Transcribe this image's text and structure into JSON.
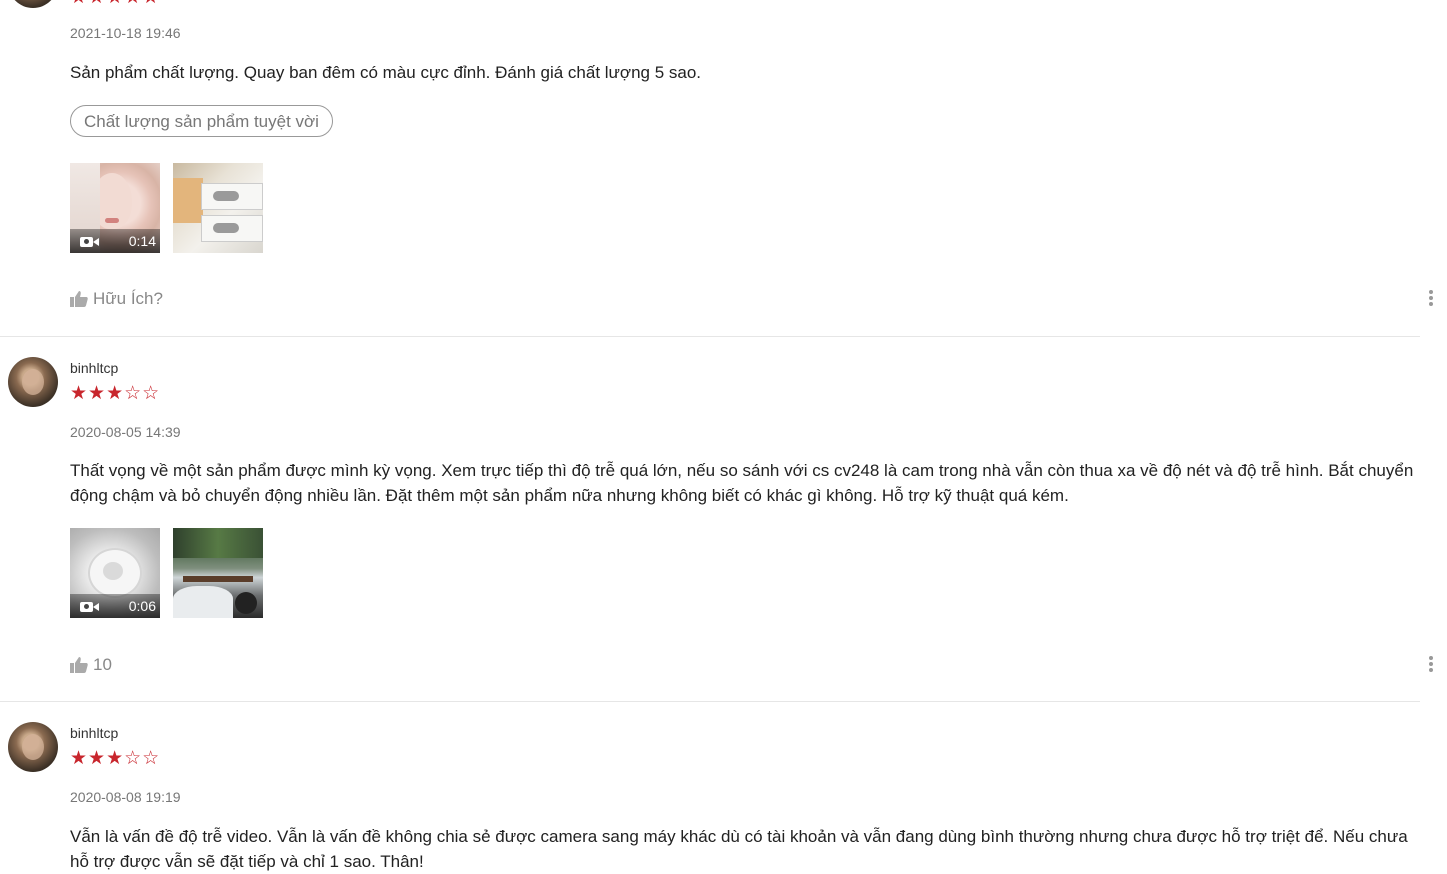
{
  "reviews": [
    {
      "date": "2021-10-18 19:46",
      "text": "Sản phẩm chất lượng. Quay ban đêm có màu cực đỉnh. Đánh giá chất lượng 5 sao.",
      "tag": "Chất lượng sản phẩm tuyệt vời",
      "video_duration": "0:14",
      "helpful_label": "Hữu Ích?"
    },
    {
      "username": "binhltcp",
      "rating": 3,
      "date": "2020-08-05 14:39",
      "text": "Thất vọng về một sản phẩm được mình kỳ vọng. Xem trực tiếp thì độ trễ quá lớn, nếu so sánh với cs cv248 là cam trong nhà vẫn còn thua xa về độ nét và độ trễ hình. Bắt chuyển động chậm và bỏ chuyển động nhiều lần. Đặt thêm một sản phẩm nữa nhưng không biết có khác gì không. Hỗ trợ kỹ thuật quá kém.",
      "video_duration": "0:06",
      "helpful_count": "10"
    },
    {
      "username": "binhltcp",
      "rating": 3,
      "date": "2020-08-08 19:19",
      "text": "Vẫn là vấn đề độ trễ video. Vẫn là vấn đề không chia sẻ được camera sang máy khác dù có tài khoản và vẫn đang dùng bình thường nhưng chưa được hỗ trợ triệt để. Nếu chưa hỗ trợ được vẫn sẽ đặt tiếp và chỉ 1 sao. Thân!"
    }
  ],
  "icons": {
    "star_full": "★",
    "star_empty": "☆",
    "accent_color": "#c8262d"
  }
}
